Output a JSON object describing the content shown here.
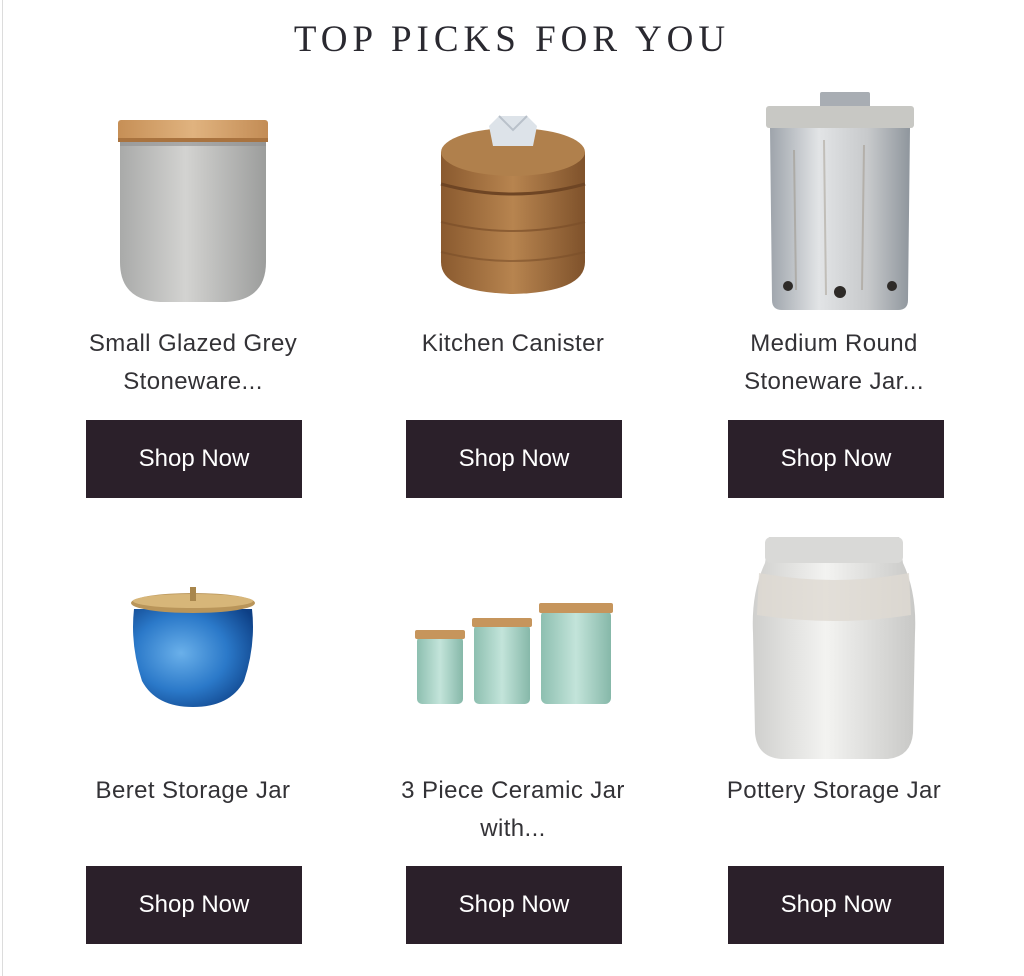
{
  "section": {
    "title": "TOP PICKS FOR YOU"
  },
  "products": [
    {
      "name_line1": "Small Glazed Grey",
      "name_line2": "Stoneware...",
      "button": "Shop Now",
      "image": "grey-stoneware-canister"
    },
    {
      "name_line1": "Kitchen Canister",
      "name_line2": "",
      "button": "Shop Now",
      "image": "wooden-canister"
    },
    {
      "name_line1": "Medium Round",
      "name_line2": "Stoneware Jar...",
      "button": "Shop Now",
      "image": "white-stoneware-jar"
    },
    {
      "name_line1": "Beret Storage Jar",
      "name_line2": "",
      "button": "Shop Now",
      "image": "blue-glass-jar"
    },
    {
      "name_line1": "3 Piece Ceramic Jar",
      "name_line2": "with...",
      "button": "Shop Now",
      "image": "mint-ceramic-jar-set"
    },
    {
      "name_line1": "Pottery Storage Jar",
      "name_line2": "",
      "button": "Shop Now",
      "image": "white-pottery-jar"
    }
  ],
  "colors": {
    "button_bg": "#2b202a",
    "button_text": "#ffffff",
    "text": "#333236"
  }
}
